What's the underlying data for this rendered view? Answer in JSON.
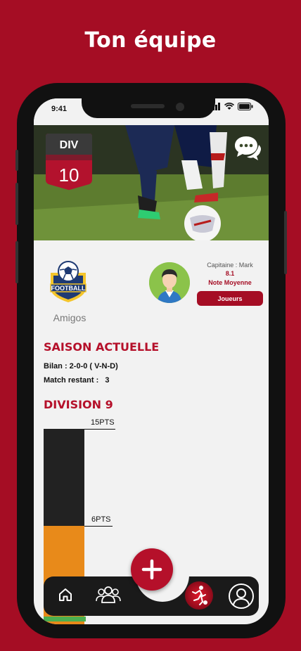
{
  "hero": {
    "title": "Ton équipe"
  },
  "status_bar": {
    "time": "9:41"
  },
  "banner": {
    "div_label": "DIV",
    "div_number": "10",
    "chat_icon": "chat-bubbles-icon"
  },
  "team": {
    "logo_text": "FOOTBALL",
    "name": "Amigos"
  },
  "captain": {
    "label": "Capitaine : Mark",
    "rating": "8.1",
    "rating_label": "Note Moyenne",
    "players_button": "Joueurs"
  },
  "season": {
    "title": "SAISON ACTUELLE",
    "record": "Bilan : 2-0-0 ( V-N-D)",
    "remaining_label": "Match restant :",
    "remaining_value": "3"
  },
  "division": {
    "title": "DIVISION 9",
    "top_label": "15PTS",
    "mid_label": "6PTS",
    "top_points": 15,
    "mid_points": 6
  },
  "nav": {
    "items": [
      {
        "icon": "home-icon"
      },
      {
        "icon": "team-icon"
      },
      {
        "icon": "football-player-icon"
      },
      {
        "icon": "profile-icon"
      }
    ],
    "fab_icon": "plus-icon"
  },
  "colors": {
    "brand_red": "#a50d24",
    "accent_orange": "#e88a1a",
    "dark_bar": "#222222",
    "progress_green": "#4caf50"
  }
}
